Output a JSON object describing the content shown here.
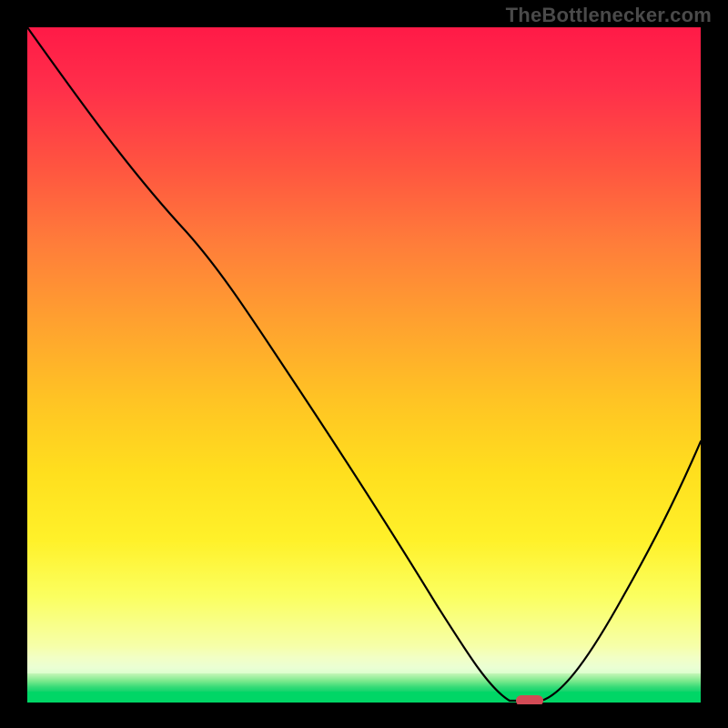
{
  "watermark": "TheBottlenecker.com",
  "chart_data": {
    "type": "line",
    "title": "",
    "xlabel": "",
    "ylabel": "",
    "xlim": [
      0,
      100
    ],
    "ylim": [
      0,
      100
    ],
    "x": [
      0,
      5,
      12,
      20,
      27,
      33,
      40,
      47,
      53,
      58,
      63,
      67,
      70,
      73,
      76,
      80,
      84,
      88,
      92,
      96,
      100
    ],
    "values": [
      100,
      92,
      82,
      73,
      65,
      58,
      48,
      38,
      28,
      20,
      12,
      6,
      2,
      0,
      0,
      2,
      8,
      16,
      25,
      35,
      46
    ],
    "series": [
      {
        "name": "bottleneck-curve",
        "x": [
          0,
          5,
          12,
          20,
          27,
          33,
          40,
          47,
          53,
          58,
          63,
          67,
          70,
          73,
          76,
          80,
          84,
          88,
          92,
          96,
          100
        ],
        "values": [
          100,
          92,
          82,
          73,
          65,
          58,
          48,
          38,
          28,
          20,
          12,
          6,
          2,
          0,
          0,
          2,
          8,
          16,
          25,
          35,
          46
        ]
      }
    ],
    "minimum_marker": {
      "x": 74.5,
      "y": 0
    },
    "gradient_stops": [
      {
        "pos": 0.0,
        "color": "#ff1a47"
      },
      {
        "pos": 0.35,
        "color": "#ff7d3a"
      },
      {
        "pos": 0.6,
        "color": "#ffc324"
      },
      {
        "pos": 0.83,
        "color": "#fff12a"
      },
      {
        "pos": 0.95,
        "color": "#eaffd4"
      },
      {
        "pos": 1.0,
        "color": "#00d666"
      }
    ]
  }
}
